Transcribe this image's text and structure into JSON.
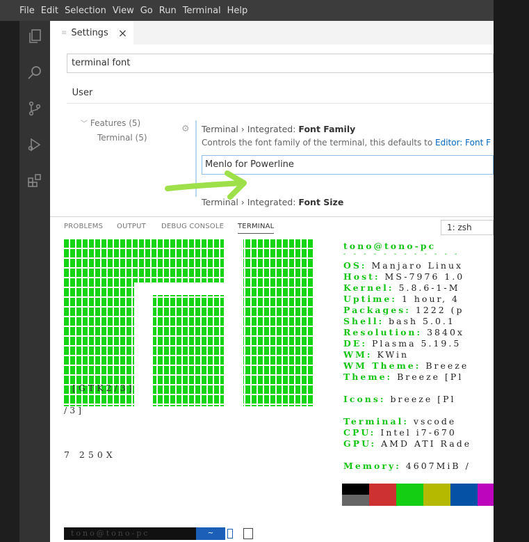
{
  "menu": [
    "File",
    "Edit",
    "Selection",
    "View",
    "Go",
    "Run",
    "Terminal",
    "Help"
  ],
  "tab": {
    "label": "Settings",
    "icon": "settings-file-icon",
    "close": "×"
  },
  "search": {
    "value": "terminal font"
  },
  "scope_tab": "User",
  "toc": {
    "features": "Features (5)",
    "terminal": "Terminal (5)"
  },
  "setting1": {
    "prefix": "Terminal › Integrated: ",
    "name": "Font Family",
    "description": "Controls the font family of the terminal, this defaults to ",
    "link": "Editor: Font F",
    "value": "Menlo for Powerline"
  },
  "setting2": {
    "prefix": "Terminal › Integrated: ",
    "name": "Font Size"
  },
  "panel_tabs": [
    "PROBLEMS",
    "OUTPUT",
    "DEBUG CONSOLE",
    "TERMINAL"
  ],
  "shell_select": "1: zsh",
  "terminal": {
    "userhost": "tono@tono-pc",
    "dashes": "- - - - - - - - - - - -",
    "info": [
      {
        "key": "OS:",
        "value": " Manjaro Linux"
      },
      {
        "key": "Host:",
        "value": " MS-7976 1.0"
      },
      {
        "key": "Kernel:",
        "value": " 5.8.6-1-M"
      },
      {
        "key": "Uptime:",
        "value": " 1 hour, 4"
      },
      {
        "key": "Packages:",
        "value": " 1222 (p"
      },
      {
        "key": "Shell:",
        "value": " bash 5.0.1"
      },
      {
        "key": "Resolution:",
        "value": " 3840x"
      },
      {
        "key": "DE:",
        "value": " Plasma 5.19.5"
      },
      {
        "key": "WM:",
        "value": " KWin"
      },
      {
        "key": "WM Theme:",
        "value": " Breeze"
      },
      {
        "key": "Theme:",
        "value": " Breeze [Pl"
      },
      {
        "key": "",
        "value": ""
      },
      {
        "key": "Icons:",
        "value": " breeze [Pl"
      },
      {
        "key": "",
        "value": ""
      },
      {
        "key": "Terminal:",
        "value": " vscode"
      },
      {
        "key": "CPU:",
        "value": " Intel i7-670"
      },
      {
        "key": "GPU:",
        "value": " AMD ATI Rade"
      },
      {
        "key": "",
        "value": ""
      },
      {
        "key": "",
        "value": ""
      },
      {
        "key": "Memory:",
        "value": " 4607MiB /"
      }
    ],
    "gtk_text": "[GTK2/3]",
    "slash_text": "/3]",
    "gpu_tail": "7 250X",
    "colors": [
      "#000000",
      "#cd3131",
      "#14ce14",
      "#b5ba00",
      "#0451a5",
      "#bc05bc"
    ],
    "colors_bottom": [
      "#666666",
      "#cd3131",
      "#14ce14",
      "#b5ba00",
      "#0451a5",
      "#bc05bc"
    ],
    "prompt": "tono@tono-pc",
    "prompt_dir": "~"
  },
  "accent": "#14c514"
}
